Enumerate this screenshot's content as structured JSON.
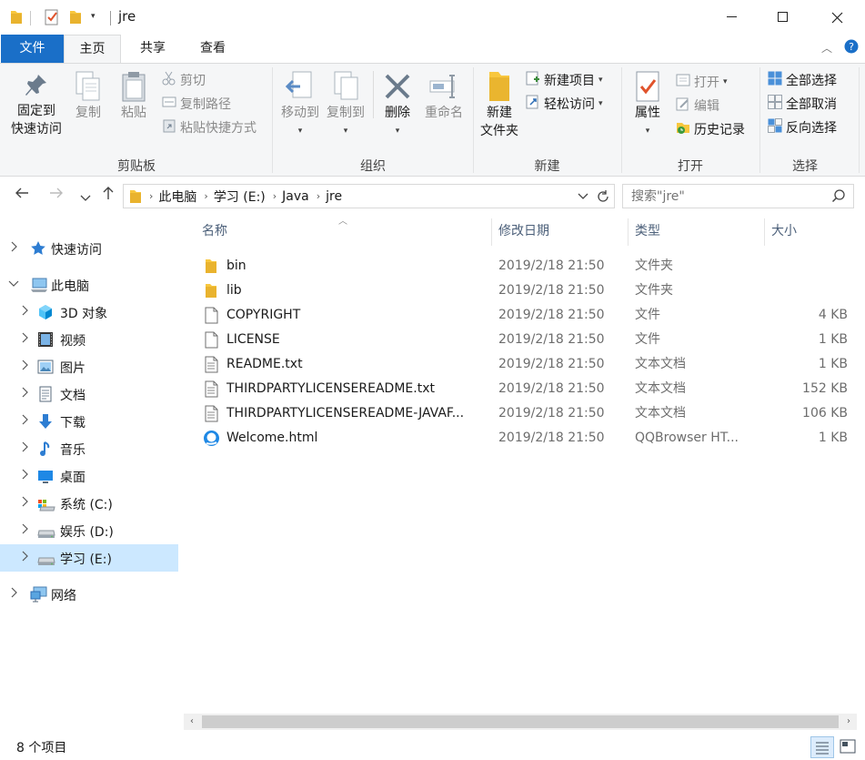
{
  "window": {
    "title": "jre",
    "controls": {
      "minimize": "minimize-icon",
      "maximize": "maximize-icon",
      "close": "close-icon"
    }
  },
  "ribbon_tabs": [
    "文件",
    "主页",
    "共享",
    "查看"
  ],
  "ribbon": {
    "clipboard": {
      "pin_line1": "固定到",
      "pin_line2": "快速访问",
      "copy": "复制",
      "paste": "粘贴",
      "cut": "剪切",
      "copy_path": "复制路径",
      "paste_shortcut": "粘贴快捷方式",
      "group": "剪贴板"
    },
    "organize": {
      "move_to": "移动到",
      "copy_to": "复制到",
      "delete": "删除",
      "rename": "重命名",
      "group": "组织"
    },
    "new": {
      "new_folder_line1": "新建",
      "new_folder_line2": "文件夹",
      "new_item": "新建项目",
      "easy_access": "轻松访问",
      "group": "新建"
    },
    "open": {
      "properties": "属性",
      "open": "打开",
      "edit": "编辑",
      "history": "历史记录",
      "group": "打开"
    },
    "select": {
      "select_all": "全部选择",
      "select_none": "全部取消",
      "invert": "反向选择",
      "group": "选择"
    }
  },
  "address": {
    "crumbs": [
      "此电脑",
      "学习 (E:)",
      "Java",
      "jre"
    ],
    "search_placeholder": "搜索\"jre\""
  },
  "nav": [
    {
      "label": "快速访问",
      "icon": "star-icon"
    },
    {
      "label": "此电脑",
      "icon": "computer-icon"
    },
    {
      "label": "3D 对象",
      "icon": "cube-icon"
    },
    {
      "label": "视频",
      "icon": "film-icon"
    },
    {
      "label": "图片",
      "icon": "picture-icon"
    },
    {
      "label": "文档",
      "icon": "document-icon"
    },
    {
      "label": "下载",
      "icon": "download-icon"
    },
    {
      "label": "音乐",
      "icon": "music-icon"
    },
    {
      "label": "桌面",
      "icon": "desktop-icon"
    },
    {
      "label": "系统 (C:)",
      "icon": "system-drive-icon"
    },
    {
      "label": "娱乐 (D:)",
      "icon": "drive-icon"
    },
    {
      "label": "学习 (E:)",
      "icon": "drive-icon"
    },
    {
      "label": "网络",
      "icon": "network-icon"
    }
  ],
  "columns": {
    "name": "名称",
    "date": "修改日期",
    "type": "类型",
    "size": "大小"
  },
  "files": [
    {
      "name": "bin",
      "date": "2019/2/18 21:50",
      "type": "文件夹",
      "size": "",
      "icon": "folder-icon"
    },
    {
      "name": "lib",
      "date": "2019/2/18 21:50",
      "type": "文件夹",
      "size": "",
      "icon": "folder-icon"
    },
    {
      "name": "COPYRIGHT",
      "date": "2019/2/18 21:50",
      "type": "文件",
      "size": "4 KB",
      "icon": "file-icon"
    },
    {
      "name": "LICENSE",
      "date": "2019/2/18 21:50",
      "type": "文件",
      "size": "1 KB",
      "icon": "file-icon"
    },
    {
      "name": "README.txt",
      "date": "2019/2/18 21:50",
      "type": "文本文档",
      "size": "1 KB",
      "icon": "text-file-icon"
    },
    {
      "name": "THIRDPARTYLICENSEREADME.txt",
      "date": "2019/2/18 21:50",
      "type": "文本文档",
      "size": "152 KB",
      "icon": "text-file-icon"
    },
    {
      "name": "THIRDPARTYLICENSEREADME-JAVAF...",
      "date": "2019/2/18 21:50",
      "type": "文本文档",
      "size": "106 KB",
      "icon": "text-file-icon"
    },
    {
      "name": "Welcome.html",
      "date": "2019/2/18 21:50",
      "type": "QQBrowser HT...",
      "size": "1 KB",
      "icon": "browser-icon"
    }
  ],
  "status": {
    "count": "8 个项目"
  },
  "colors": {
    "accent": "#1a6fc8",
    "selected": "#cce8ff",
    "folder": "#f8c73e"
  }
}
